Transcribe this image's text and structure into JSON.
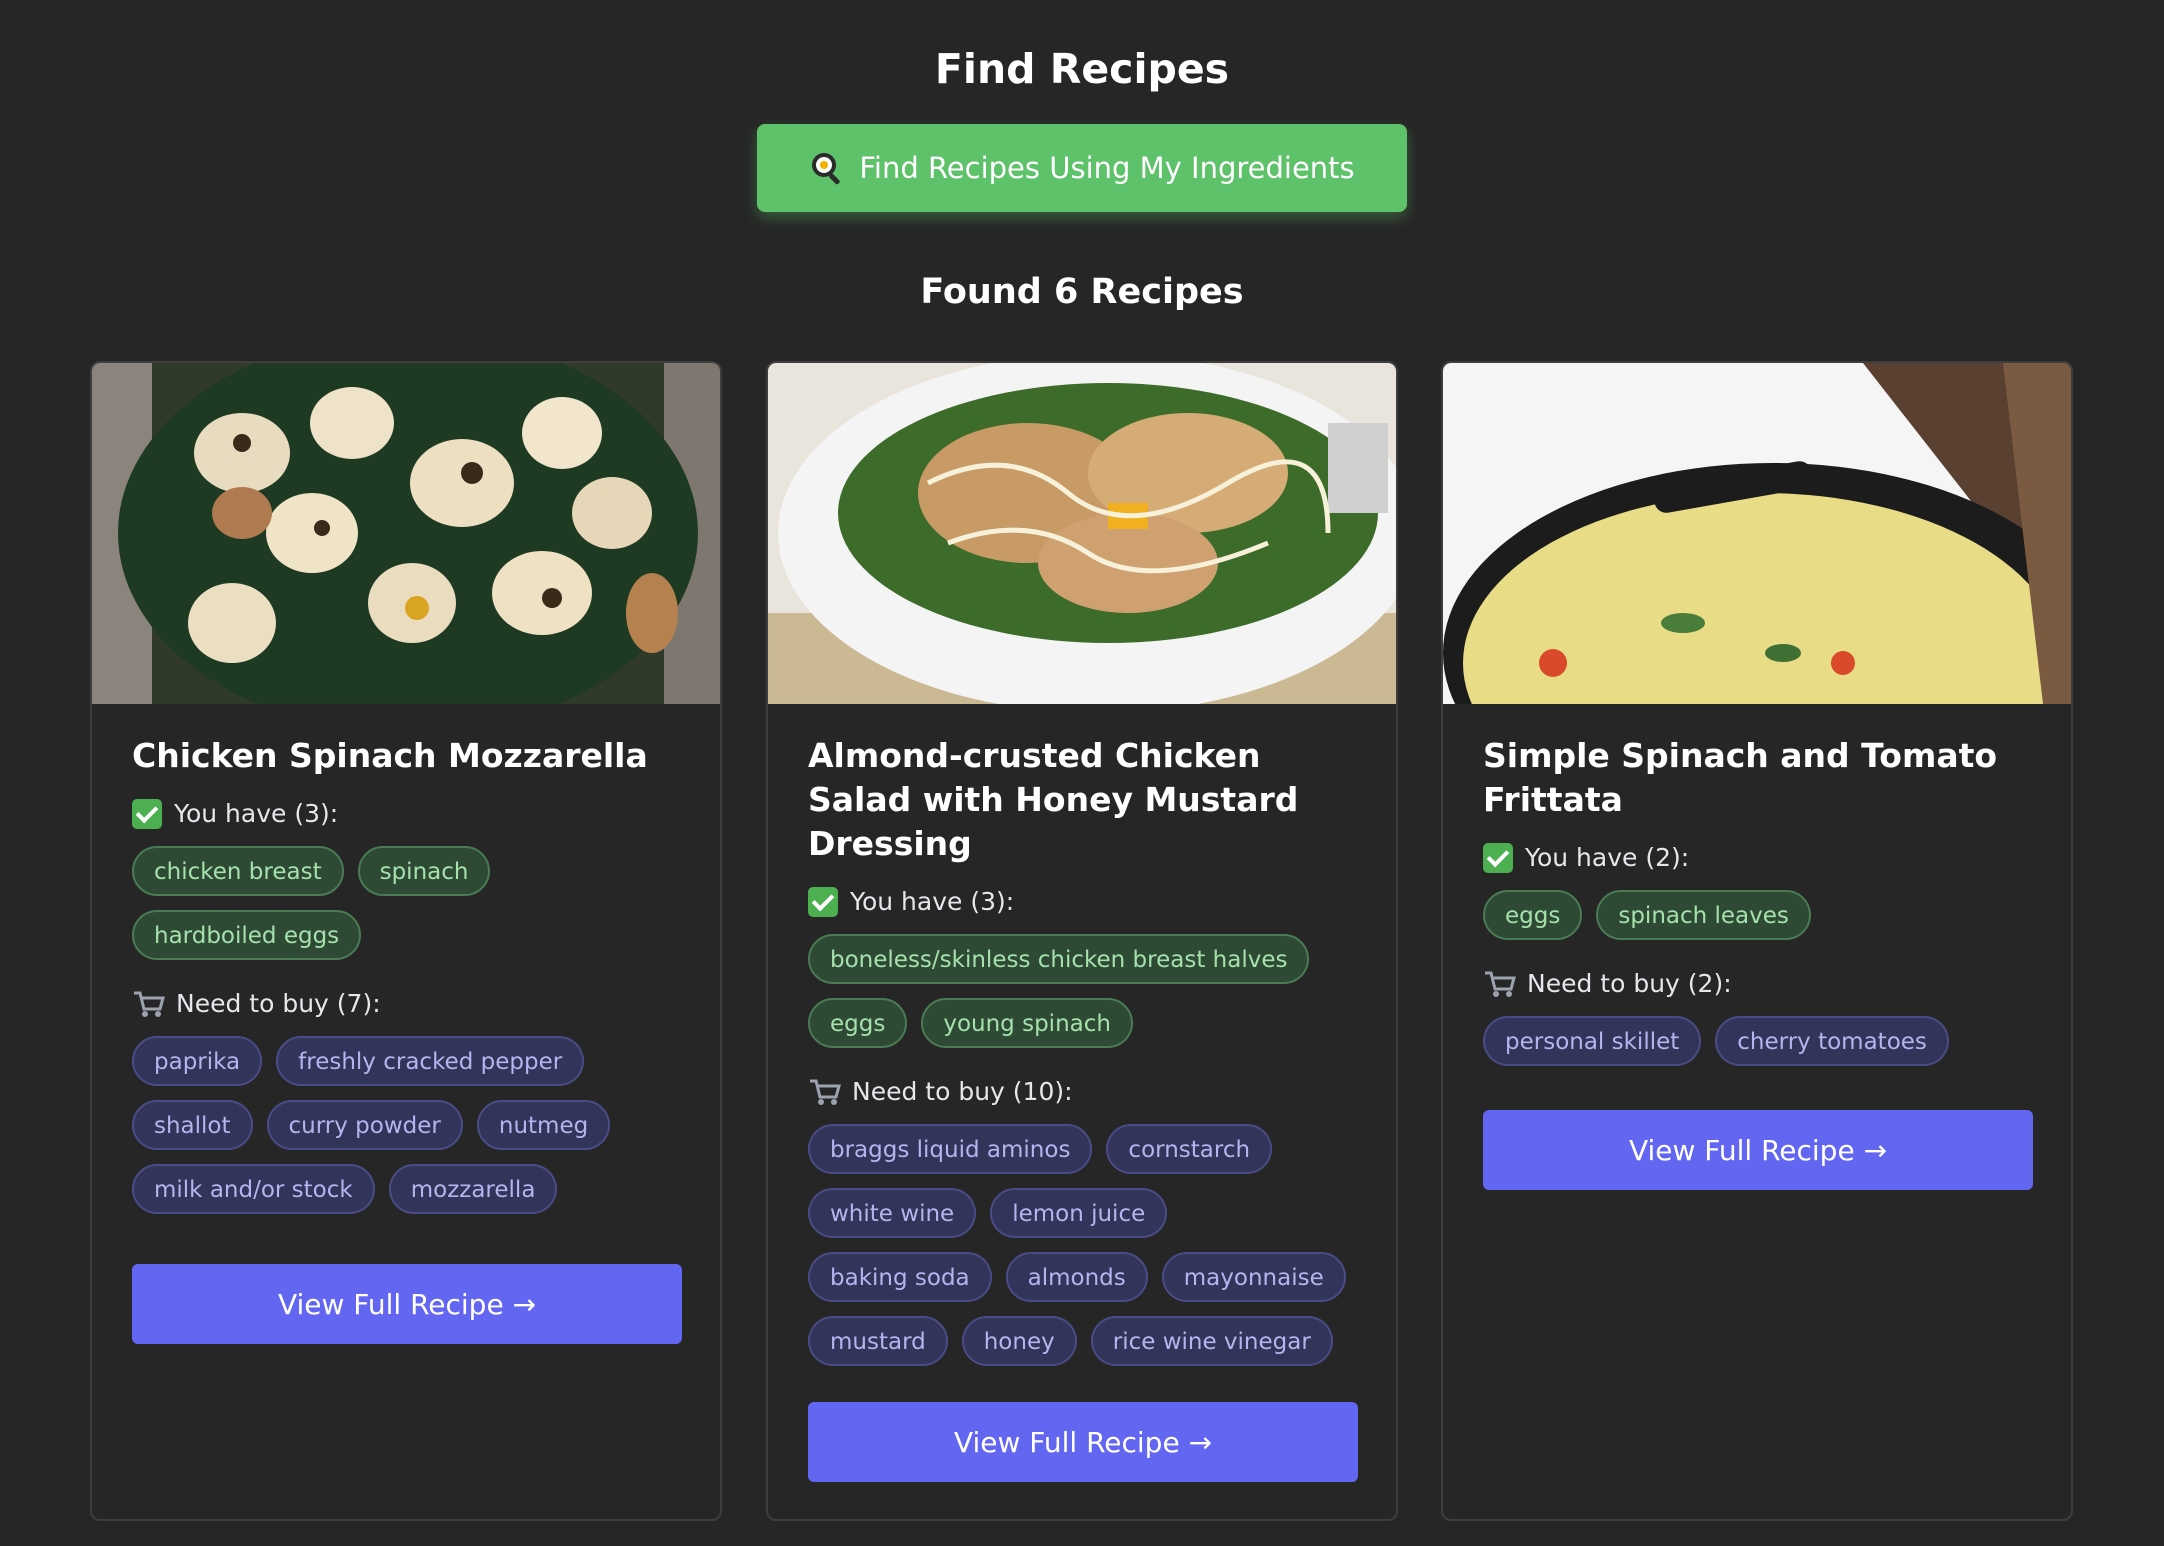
{
  "header": {
    "title": "Find Recipes",
    "find_button_label": "Find Recipes Using My Ingredients",
    "results_title": "Found 6 Recipes"
  },
  "recipes": [
    {
      "title": "Chicken Spinach Mozzarella",
      "have_label": "You have (3):",
      "have": [
        "chicken breast",
        "spinach",
        "hardboiled eggs"
      ],
      "buy_label": "Need to buy (7):",
      "buy": [
        "paprika",
        "freshly cracked pepper",
        "shallot",
        "curry powder",
        "nutmeg",
        "milk and/or stock",
        "mozzarella"
      ],
      "button_label": "View Full Recipe →"
    },
    {
      "title": "Almond-crusted Chicken Salad with Honey Mustard Dressing",
      "have_label": "You have (3):",
      "have": [
        "boneless/skinless chicken breast halves",
        "eggs",
        "young spinach"
      ],
      "buy_label": "Need to buy (10):",
      "buy": [
        "braggs liquid aminos",
        "cornstarch",
        "white wine",
        "lemon juice",
        "baking soda",
        "almonds",
        "mayonnaise",
        "mustard",
        "honey",
        "rice wine vinegar"
      ],
      "button_label": "View Full Recipe →"
    },
    {
      "title": "Simple Spinach and Tomato Frittata",
      "have_label": "You have (2):",
      "have": [
        "eggs",
        "spinach leaves"
      ],
      "buy_label": "Need to buy (2):",
      "buy": [
        "personal skillet",
        "cherry tomatoes"
      ],
      "button_label": "View Full Recipe →"
    }
  ],
  "colors": {
    "background": "#262626",
    "find_button": "#5ec26a",
    "view_button": "#6366f1",
    "have_tag_bg": "#2f4a34",
    "buy_tag_bg": "#33345a"
  }
}
